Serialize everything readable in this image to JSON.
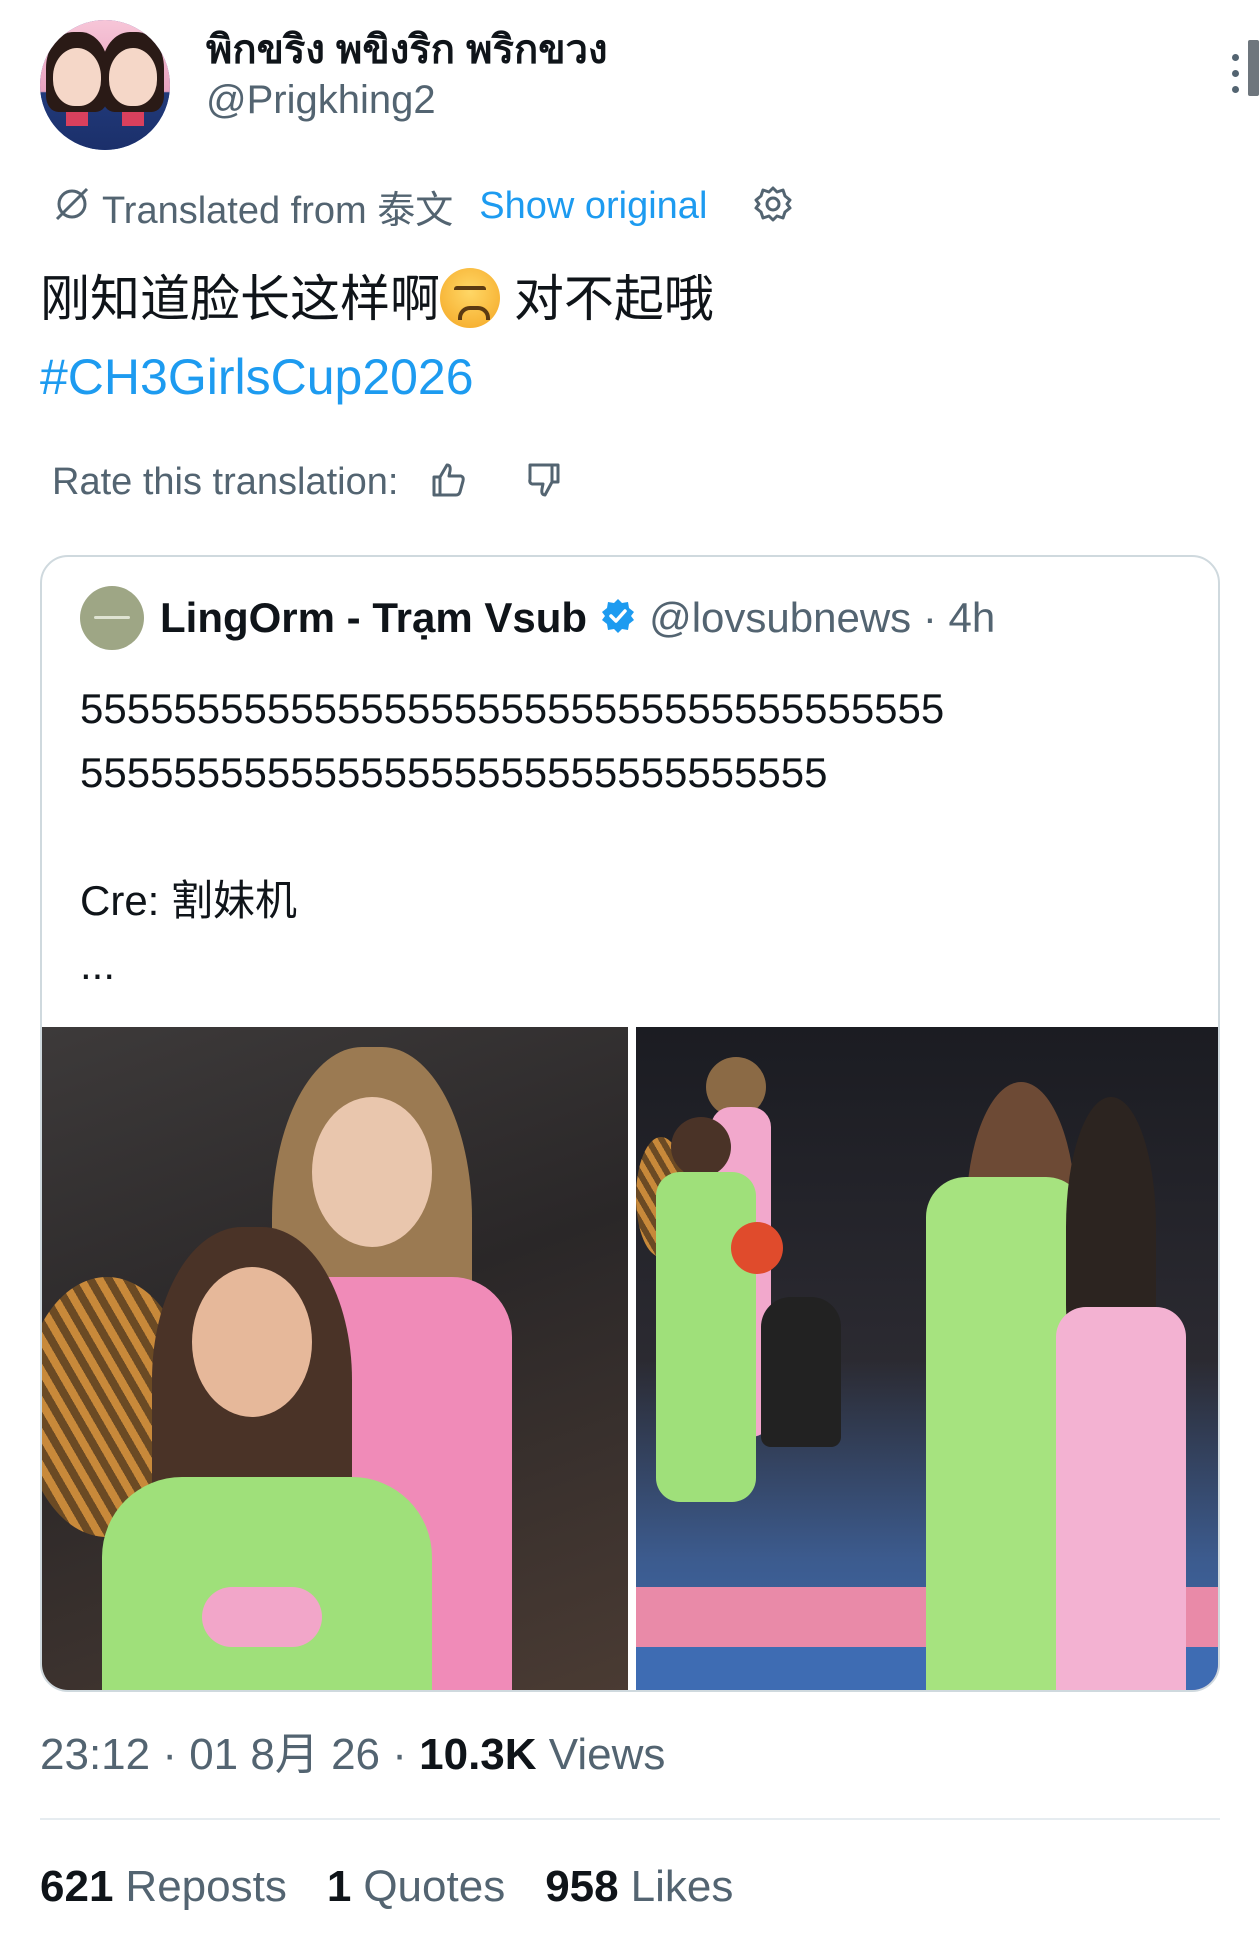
{
  "author": {
    "display_name": "พิกขริง พขิงริก พริกขวง",
    "handle": "@Prigkhing2"
  },
  "translation": {
    "translated_from": "Translated from 泰文",
    "show_original": "Show original",
    "rate_label": "Rate this translation:"
  },
  "tweet": {
    "text_part1": "刚知道脸长这样啊",
    "emoji": "persevering-face",
    "text_part2": " 对不起哦",
    "hashtag": "#CH3GirlsCup2026"
  },
  "quoted_tweet": {
    "name": "LingOrm - Trạm Vsub",
    "handle_time": "@lovsubnews · 4h",
    "text": "5555555555555555555555555555555555555\n55555555555555555555555555555555\n\nCre: 割妹机\n...",
    "images": [
      "photo-1",
      "photo-2"
    ]
  },
  "meta": {
    "time_date": "23:12 · 01 8月 26 · ",
    "views_count": "10.3K",
    "views_label": " Views"
  },
  "stats": {
    "reposts_count": "621",
    "reposts_label": "Reposts",
    "quotes_count": "1",
    "quotes_label": "Quotes",
    "likes_count": "958",
    "likes_label": "Likes"
  },
  "colors": {
    "link": "#1d9bf0",
    "secondary_text": "#536471",
    "primary_text": "#0f1419",
    "verified": "#1d9bf0"
  },
  "icons": [
    "translate-icon",
    "gear-icon",
    "thumbs-up-icon",
    "thumbs-down-icon",
    "verified-badge-icon",
    "more-options-icon"
  ]
}
